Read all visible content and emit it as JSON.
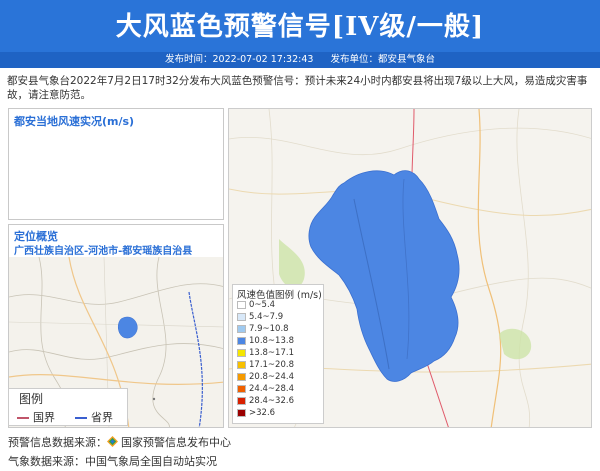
{
  "header": {
    "title": "大风蓝色预警信号[IV级/一般]",
    "publish_time_label": "发布时间：2022-07-02 17:32:43",
    "publisher_label": "发布单位：都安县气象台",
    "bg_color": "#2a74d8"
  },
  "description": "都安县气象台2022年7月2日17时32分发布大风蓝色预警信号：预计未来24小时内都安县将出现7级以上大风，易造成灾害事故，请注意防范。",
  "wind_panel": {
    "title": "都安当地风速实况(m/s)"
  },
  "location_panel": {
    "title": "定位概览",
    "subtitle": "广西壮族自治区-河池市-都安瑶族自治县"
  },
  "map_legend": {
    "title": "图例",
    "items": [
      {
        "label": "国界",
        "color": "#c0556a"
      },
      {
        "label": "省界",
        "color": "#3a5fcf"
      }
    ]
  },
  "wind_speed_legend": {
    "title": "风速色值图例 (m/s)",
    "items": [
      {
        "label": "0~5.4",
        "color": "#ffffff"
      },
      {
        "label": "5.4~7.9",
        "color": "#d8e8f8"
      },
      {
        "label": "7.9~10.8",
        "color": "#9fcaf0"
      },
      {
        "label": "10.8~13.8",
        "color": "#4c86e3"
      },
      {
        "label": "13.8~17.1",
        "color": "#f5e600"
      },
      {
        "label": "17.1~20.8",
        "color": "#f7c000"
      },
      {
        "label": "20.8~24.4",
        "color": "#f59a00"
      },
      {
        "label": "24.4~28.4",
        "color": "#f06000"
      },
      {
        "label": "28.4~32.6",
        "color": "#d82000"
      },
      {
        "label": ">32.6",
        "color": "#9a0000"
      }
    ]
  },
  "map": {
    "alert_area_color": "#4c86e3"
  },
  "footer": {
    "source1_label": "预警信息数据来源：",
    "source1_value": "国家预警信息发布中心",
    "source2": "气象数据来源：中国气象局全国自动站实况"
  }
}
